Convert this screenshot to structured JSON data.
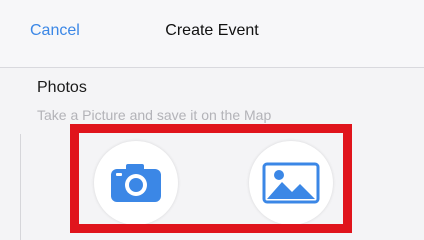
{
  "navbar": {
    "cancel_label": "Cancel",
    "title": "Create Event"
  },
  "photos": {
    "heading": "Photos",
    "hint": "Take a Picture and save it on the Map"
  },
  "icons": {
    "camera": "camera-icon",
    "gallery": "image-gallery-icon"
  },
  "colors": {
    "accent": "#3b87e6",
    "highlight": "#e0141c"
  }
}
